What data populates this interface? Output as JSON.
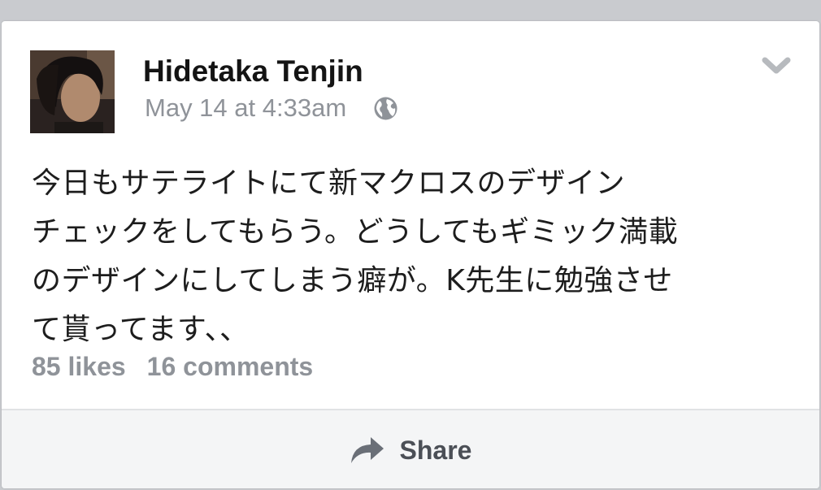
{
  "post": {
    "author": {
      "name": "Hidetaka Tenjin",
      "avatar": "profile-photo"
    },
    "timestamp": "May 14 at 4:33am",
    "privacy_icon": "globe-icon",
    "options_icon": "chevron-down-icon",
    "text_lines": [
      "今日もサテライトにて新マクロスのデザイン",
      "チェックをしてもらう。どうしてもギミック満載",
      "のデザインにしてしまう癖が。K先生に勉強させ",
      "て貰ってます、、"
    ],
    "stats": {
      "likes": "85 likes",
      "comments": "16 comments"
    }
  },
  "actions": {
    "share_label": "Share",
    "share_icon": "share-arrow-icon"
  },
  "colors": {
    "background": "#c9cbcf",
    "card": "#ffffff",
    "name_text": "#141414",
    "meta_text": "#8f9399",
    "action_bar": "#f4f5f6",
    "action_text": "#4b4f56"
  }
}
